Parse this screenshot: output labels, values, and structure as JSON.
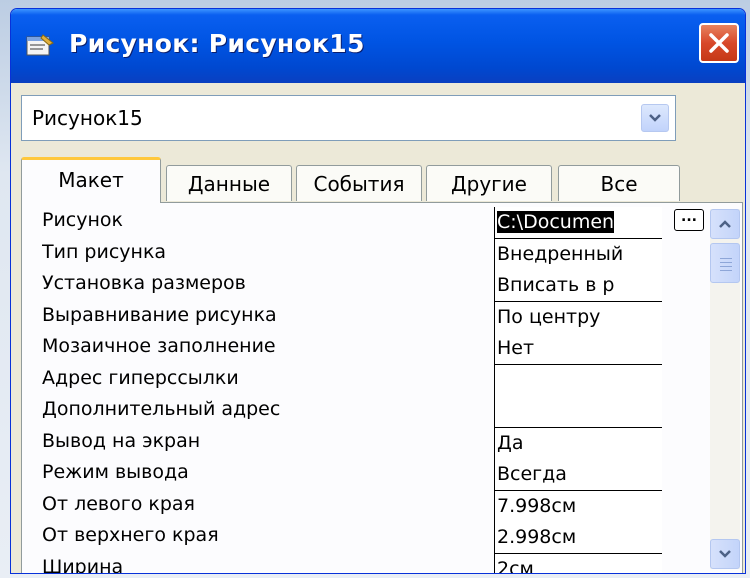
{
  "window": {
    "title": "Рисунок: Рисунок15"
  },
  "combo": {
    "value": "Рисунок15"
  },
  "tabs": [
    {
      "label": "Макет",
      "active": true
    },
    {
      "label": "Данные",
      "active": false
    },
    {
      "label": "События",
      "active": false
    },
    {
      "label": "Другие",
      "active": false
    },
    {
      "label": "Все",
      "active": false
    }
  ],
  "properties": [
    {
      "label": "Рисунок",
      "value": "C:\\Documen",
      "selected": true
    },
    {
      "label": "Тип рисунка",
      "value": "Внедренный"
    },
    {
      "label": "Установка размеров",
      "value": "Вписать в р"
    },
    {
      "label": "Выравнивание рисунка",
      "value": "По центру"
    },
    {
      "label": "Мозаичное заполнение",
      "value": "Нет"
    },
    {
      "label": "Адрес гиперссылки",
      "value": ""
    },
    {
      "label": "Дополнительный адрес",
      "value": ""
    },
    {
      "label": "Вывод на экран",
      "value": "Да"
    },
    {
      "label": "Режим вывода",
      "value": "Всегда"
    },
    {
      "label": "От левого края",
      "value": "7.998см"
    },
    {
      "label": "От верхнего края",
      "value": "2.998см"
    },
    {
      "label": "Ширина",
      "value": "2см"
    }
  ],
  "builder_button": {
    "label": "..."
  },
  "icons": {
    "title": "properties-icon",
    "close": "close-icon",
    "dropdown": "chevron-down-icon",
    "scroll_up": "scroll-up-icon",
    "scroll_down": "scroll-down-icon"
  },
  "colors": {
    "titlebar": "#0054e3",
    "active_tab_accent": "#ffc83c",
    "close_button": "#d8482a",
    "selection": "#000000"
  }
}
